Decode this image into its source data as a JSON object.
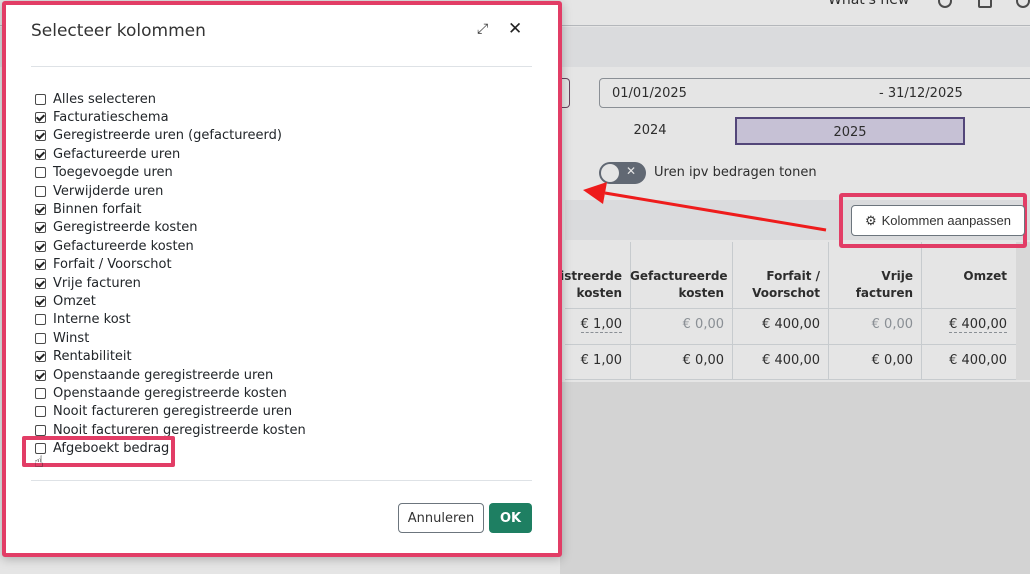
{
  "topbar": {
    "whats_new": "What's new"
  },
  "filters": {
    "date_from": "01/01/2025",
    "date_to": "-  31/12/2025",
    "years": [
      "2024",
      "2025"
    ],
    "toggle_label": "Uren ipv bedragen tonen",
    "adjust_columns_label": "Kolommen aanpassen"
  },
  "table": {
    "headers": [
      {
        "line1": "gistreerde",
        "line2": "kosten"
      },
      {
        "line1": "Gefactureerde",
        "line2": "kosten"
      },
      {
        "line1": "Forfait /",
        "line2": "Voorschot"
      },
      {
        "line1": "Vrije",
        "line2": "facturen"
      },
      {
        "line1": "",
        "line2": "Omzet"
      }
    ],
    "rows": [
      [
        "€ 1,00",
        "€ 0,00",
        "€ 400,00",
        "€ 0,00",
        "€ 400,00"
      ],
      [
        "€ 1,00",
        "€ 0,00",
        "€ 400,00",
        "€ 0,00",
        "€ 400,00"
      ]
    ]
  },
  "modal": {
    "title": "Selecteer kolommen",
    "columns": [
      {
        "label": "Alles selecteren",
        "checked": false
      },
      {
        "label": "Facturatieschema",
        "checked": true
      },
      {
        "label": "Geregistreerde uren (gefactureerd)",
        "checked": true
      },
      {
        "label": "Gefactureerde uren",
        "checked": true
      },
      {
        "label": "Toegevoegde uren",
        "checked": false
      },
      {
        "label": "Verwijderde uren",
        "checked": false
      },
      {
        "label": "Binnen forfait",
        "checked": true
      },
      {
        "label": "Geregistreerde kosten",
        "checked": true
      },
      {
        "label": "Gefactureerde kosten",
        "checked": true
      },
      {
        "label": "Forfait / Voorschot",
        "checked": true
      },
      {
        "label": "Vrije facturen",
        "checked": true
      },
      {
        "label": "Omzet",
        "checked": true
      },
      {
        "label": "Interne kost",
        "checked": false
      },
      {
        "label": "Winst",
        "checked": false
      },
      {
        "label": "Rentabiliteit",
        "checked": true
      },
      {
        "label": "Openstaande geregistreerde uren",
        "checked": true
      },
      {
        "label": "Openstaande geregistreerde kosten",
        "checked": false
      },
      {
        "label": "Nooit factureren geregistreerde uren",
        "checked": false
      },
      {
        "label": "Nooit factureren geregistreerde kosten",
        "checked": false
      },
      {
        "label": "Afgeboekt bedrag",
        "checked": false
      }
    ],
    "cancel_label": "Annuleren",
    "ok_label": "OK"
  },
  "colors": {
    "highlight": "#e23d66",
    "primary": "#1e7f62",
    "active_tab": "#ddd7ee"
  }
}
